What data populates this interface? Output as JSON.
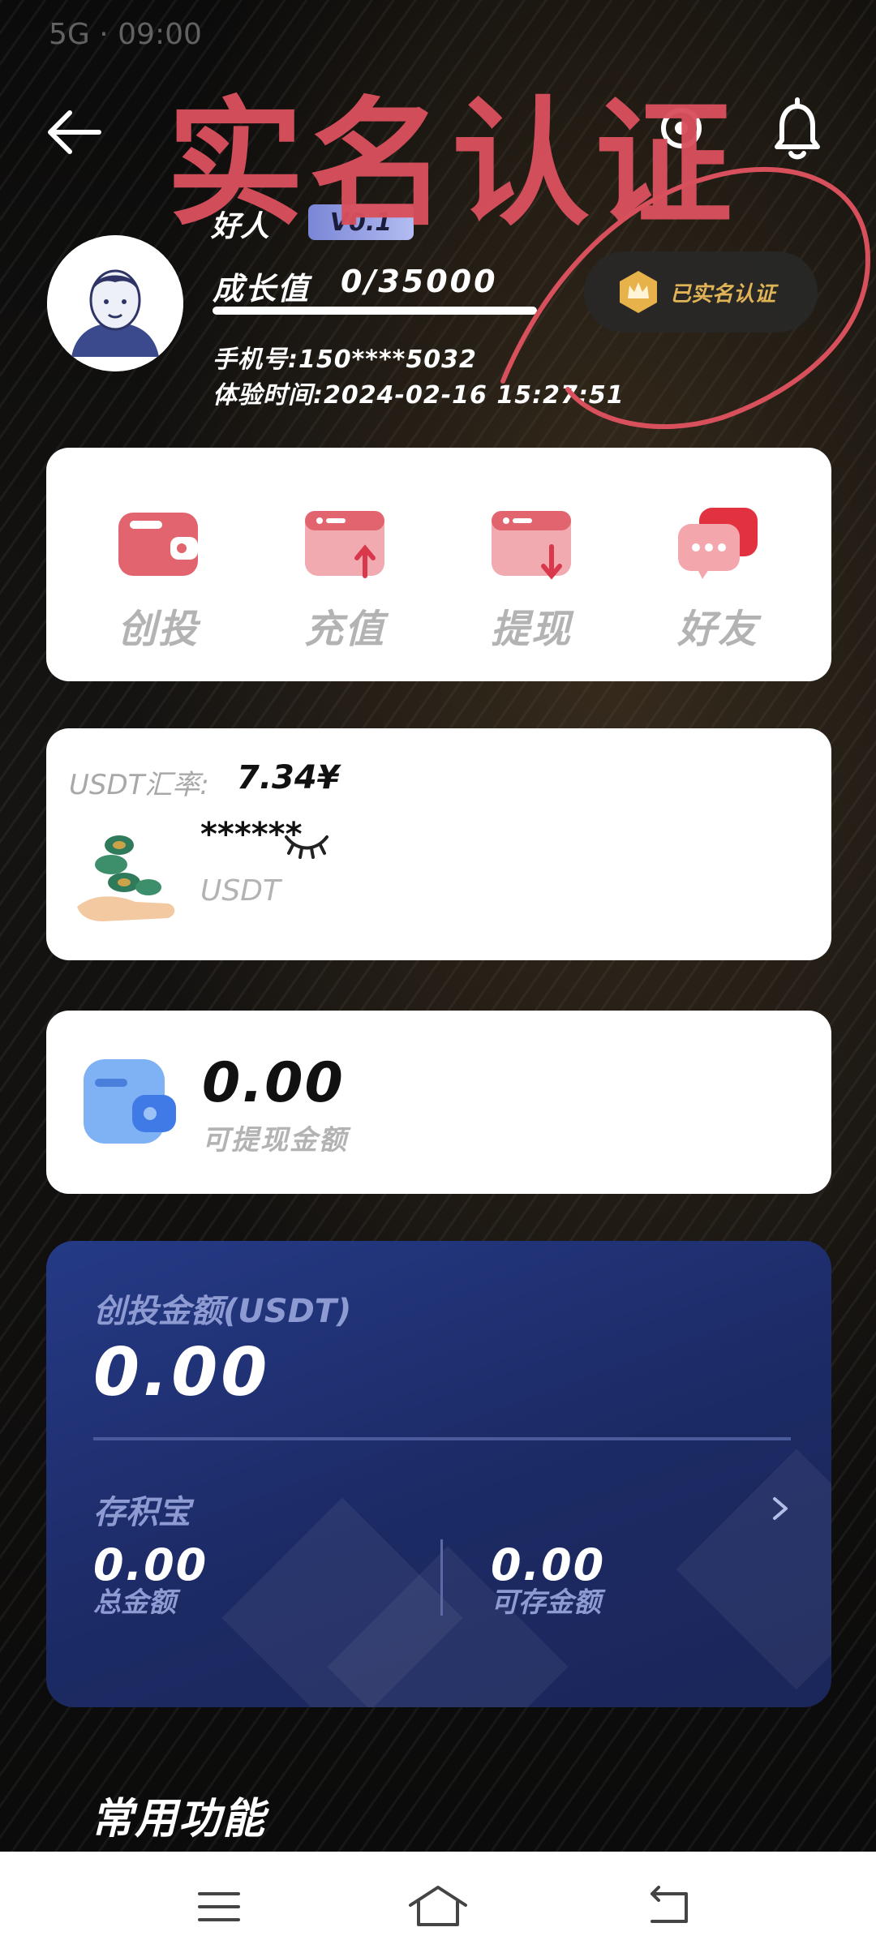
{
  "status_bar": {
    "text": "5G  ·  09:00"
  },
  "overlay": {
    "watermark_text": "实名认证"
  },
  "profile": {
    "nickname": "好人",
    "vip_badge": "V0.1",
    "growth_label": "成长值",
    "growth_value": "0/35000",
    "phone": "手机号:150****5032",
    "experience_time": "体验时间:2024-02-16 15:27:51",
    "verified_label": "已实名认证"
  },
  "actions": [
    {
      "label": "创投",
      "icon": "wallet-icon"
    },
    {
      "label": "充值",
      "icon": "recharge-icon"
    },
    {
      "label": "提现",
      "icon": "withdraw-icon"
    },
    {
      "label": "好友",
      "icon": "chat-friends-icon"
    }
  ],
  "usdt_card": {
    "rate_label": "USDT汇率:",
    "rate_value": "7.34¥",
    "hidden_amount": "******",
    "unit": "USDT"
  },
  "withdraw_card": {
    "amount": "0.00",
    "label": "可提现金额"
  },
  "invest_card": {
    "title": "创投金额(USDT)",
    "amount": "0.00",
    "save_title": "存积宝",
    "total_value": "0.00",
    "total_label": "总金额",
    "available_value": "0.00",
    "available_label": "可存金额"
  },
  "section": {
    "common_functions": "常用功能"
  },
  "colors": {
    "accent_red": "#d9505d",
    "gold": "#e0b456",
    "invest_card_bg": "#1c2a64",
    "muted_text": "#b3b3b3"
  }
}
